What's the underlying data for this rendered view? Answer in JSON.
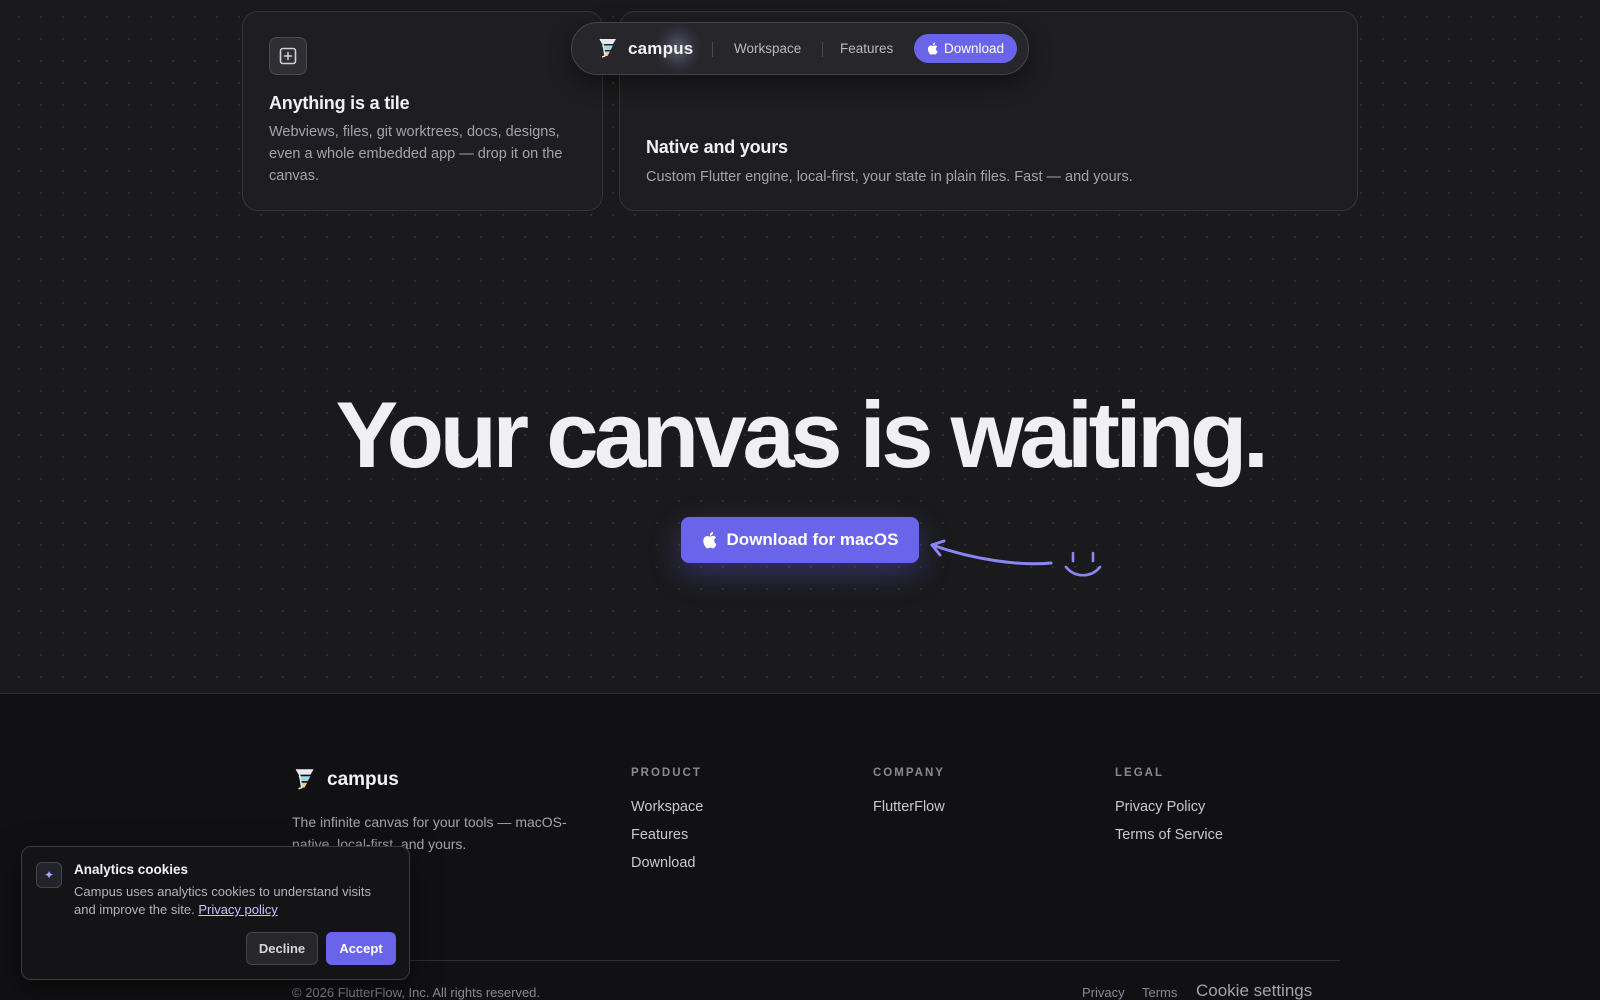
{
  "nav": {
    "brand": "campus",
    "links": [
      {
        "label": "Workspace"
      },
      {
        "label": "Features"
      }
    ],
    "download_label": "Download"
  },
  "cards": [
    {
      "title": "Anything is a tile",
      "description": "Webviews, files, git worktrees, docs, designs, even a whole embedded app — drop it on the canvas.",
      "icon": "plus-square-icon"
    },
    {
      "title": "Native and yours",
      "description": "Custom Flutter engine, local-first, your state in plain files. Fast — and yours."
    }
  ],
  "hero": {
    "title": "Your canvas is waiting.",
    "cta_label": "Download for macOS"
  },
  "footer": {
    "brand": "campus",
    "tagline": "The infinite canvas for your tools — macOS-native, local-first, and yours.",
    "columns": [
      {
        "heading": "PRODUCT",
        "links": [
          "Workspace",
          "Features",
          "Download"
        ]
      },
      {
        "heading": "COMPANY",
        "links": [
          "FlutterFlow"
        ]
      },
      {
        "heading": "LEGAL",
        "links": [
          "Privacy Policy",
          "Terms of Service"
        ]
      }
    ],
    "copyright": "© 2026 FlutterFlow, Inc. All rights reserved.",
    "bottom_links": {
      "privacy": "Privacy",
      "terms": "Terms",
      "cookie_settings": "Cookie settings"
    }
  },
  "cookie_banner": {
    "title": "Analytics cookies",
    "text": "Campus uses analytics cookies to understand visits and improve the site.",
    "link": "Privacy policy",
    "decline": "Decline",
    "accept": "Accept"
  },
  "colors": {
    "accent": "#6a64ea",
    "background": "#1a1a1c",
    "footer_background": "#111113"
  }
}
